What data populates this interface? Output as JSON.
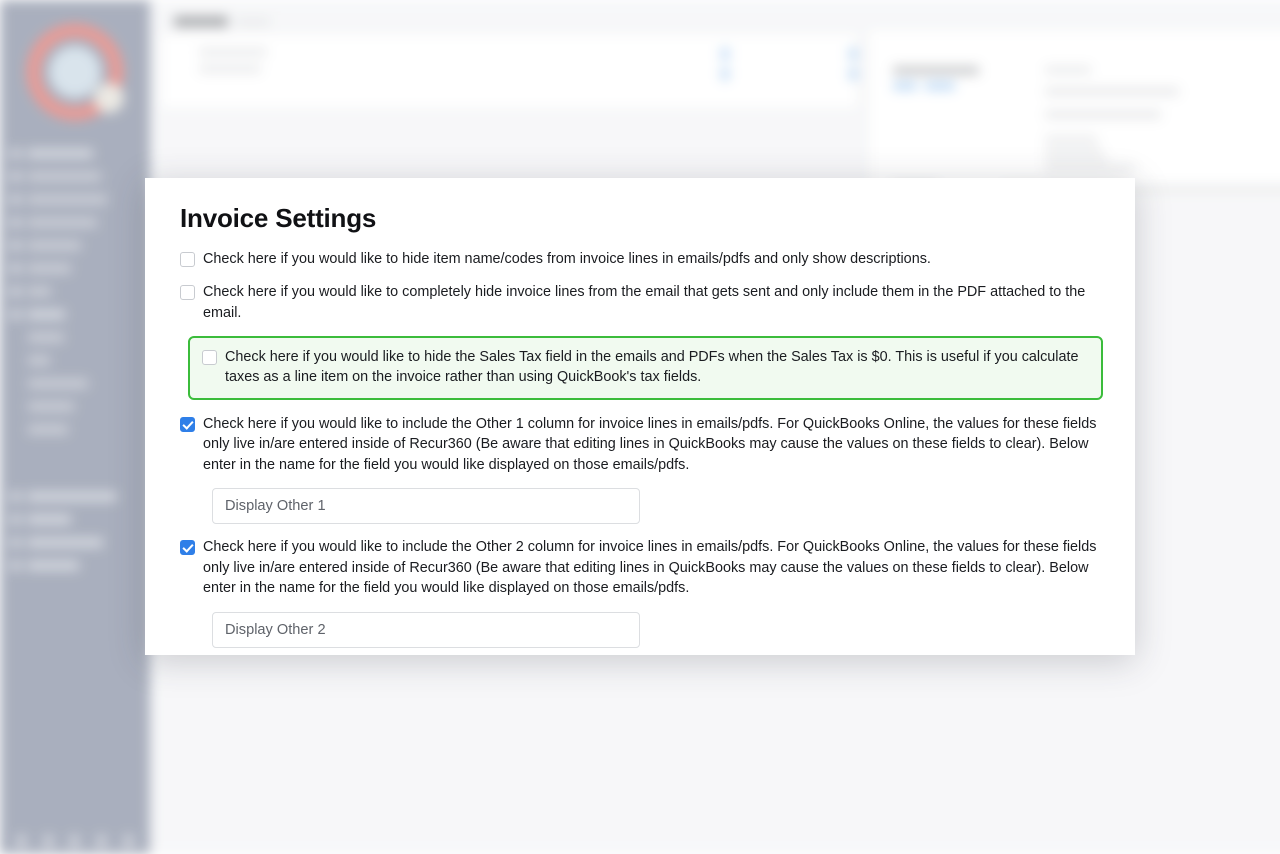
{
  "modal": {
    "title": "Invoice Settings",
    "options": [
      {
        "id": "hide-item-names",
        "checked": false,
        "highlighted": false,
        "label": "Check here if you would like to hide item name/codes from invoice lines in emails/pdfs and only show descriptions."
      },
      {
        "id": "hide-invoice-lines-email",
        "checked": false,
        "highlighted": false,
        "label": "Check here if you would like to completely hide invoice lines from the email that gets sent and only include them in the PDF attached to the email."
      },
      {
        "id": "hide-sales-tax-zero",
        "checked": false,
        "highlighted": true,
        "label": "Check here if you would like to hide the Sales Tax field in the emails and PDFs when the Sales Tax is $0. This is useful if you calculate taxes as a line item on the invoice rather than using QuickBook's tax fields."
      },
      {
        "id": "include-other-1",
        "checked": true,
        "highlighted": false,
        "label": "Check here if you would like to include the Other 1 column for invoice lines in emails/pdfs. For QuickBooks Online, the values for these fields only live in/are entered inside of Recur360 (Be aware that editing lines in QuickBooks may cause the values on these fields to clear). Below enter in the name for the field you would like displayed on those emails/pdfs."
      },
      {
        "id": "include-other-2",
        "checked": true,
        "highlighted": false,
        "label": "Check here if you would like to include the Other 2 column for invoice lines in emails/pdfs. For QuickBooks Online, the values for these fields only live in/are entered inside of Recur360 (Be aware that editing lines in QuickBooks may cause the values on these fields to clear). Below enter in the name for the field you would like displayed on those emails/pdfs."
      }
    ],
    "fields": [
      {
        "id": "display-other-1",
        "placeholder": "Display Other 1",
        "value": ""
      },
      {
        "id": "display-other-2",
        "placeholder": "Display Other 2",
        "value": ""
      }
    ]
  },
  "colors": {
    "highlight_border": "#3bbc3b",
    "highlight_fill": "#f1faf0",
    "checkbox_checked": "#2f7fe8",
    "sidebar": "#8d95a8",
    "logo_ring": "#e8786f",
    "action_button": "#93de9f"
  }
}
